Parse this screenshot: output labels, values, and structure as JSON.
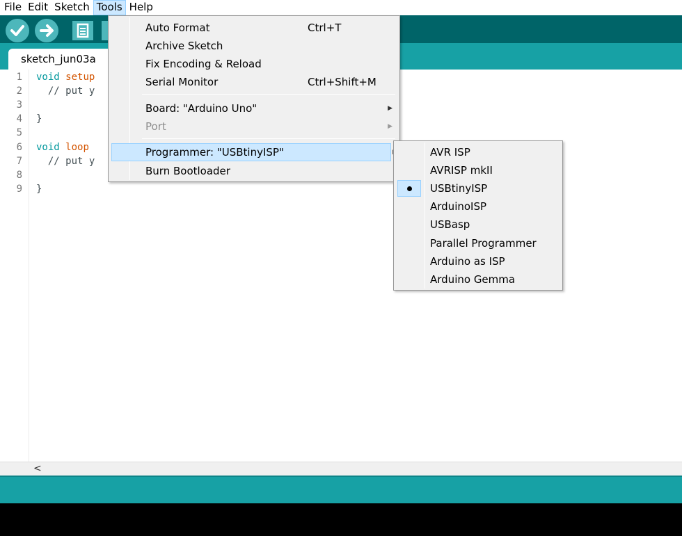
{
  "menubar": {
    "items": [
      "File",
      "Edit",
      "Sketch",
      "Tools",
      "Help"
    ],
    "active": "Tools"
  },
  "tab": {
    "label": "sketch_jun03a"
  },
  "editor": {
    "line_numbers": [
      "1",
      "2",
      "3",
      "4",
      "5",
      "6",
      "7",
      "8",
      "9"
    ],
    "lines": [
      {
        "kw": "void",
        "fn": "setup",
        "rest": ""
      },
      {
        "text": "  // put y"
      },
      {
        "text": ""
      },
      {
        "text": "}"
      },
      {
        "text": ""
      },
      {
        "kw": "void",
        "fn": "loop",
        "rest": ""
      },
      {
        "text": "  // put y"
      },
      {
        "text": ""
      },
      {
        "text": "}"
      }
    ]
  },
  "hscroll": {
    "left_arrow": "<"
  },
  "tools_menu": {
    "items": [
      {
        "label": "Auto Format",
        "shortcut": "Ctrl+T"
      },
      {
        "label": "Archive Sketch",
        "shortcut": ""
      },
      {
        "label": "Fix Encoding & Reload",
        "shortcut": ""
      },
      {
        "label": "Serial Monitor",
        "shortcut": "Ctrl+Shift+M"
      },
      {
        "label": "Board: \"Arduino Uno\"",
        "shortcut": ""
      },
      {
        "label": "Port",
        "shortcut": ""
      },
      {
        "label": "Programmer: \"USBtinyISP\"",
        "shortcut": ""
      },
      {
        "label": "Burn Bootloader",
        "shortcut": ""
      }
    ]
  },
  "programmer_menu": {
    "items": [
      "AVR ISP",
      "AVRISP mkII",
      "USBtinyISP",
      "ArduinoISP",
      "USBasp",
      "Parallel Programmer",
      "Arduino as ISP",
      "Arduino Gemma"
    ],
    "selected": "USBtinyISP"
  },
  "icons": {
    "verify": "check-icon",
    "upload": "arrow-right-icon",
    "new": "new-file-icon",
    "submenu": "triangle-right-icon"
  },
  "colors": {
    "toolbar": "#006468",
    "tabstrip": "#17a1a5",
    "button": "#4db7bb",
    "highlight": "#cce8ff"
  }
}
